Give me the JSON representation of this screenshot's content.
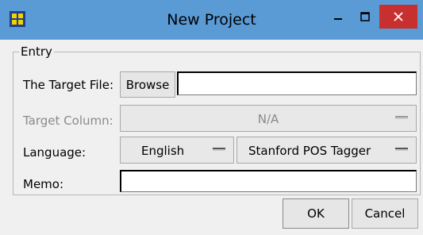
{
  "window": {
    "title": "New Project",
    "title_bar_color": "#5a9bd6",
    "close_button_color": "#c7302e"
  },
  "icons": {
    "app": "app-grid-icon",
    "minimize": "minimize-icon",
    "maximize": "maximize-icon",
    "close": "close-icon",
    "dropdown": "dropdown-bar-icon"
  },
  "entry_group": {
    "legend": "Entry",
    "target_file": {
      "label": "The Target File:",
      "browse_label": "Browse",
      "value": ""
    },
    "target_column": {
      "label": "Target Column:",
      "value": "N/A",
      "disabled": true
    },
    "language": {
      "label": "Language:",
      "value": "English",
      "tagger": "Stanford POS Tagger"
    },
    "memo": {
      "label": "Memo:",
      "value": ""
    }
  },
  "footer": {
    "ok_label": "OK",
    "cancel_label": "Cancel"
  }
}
